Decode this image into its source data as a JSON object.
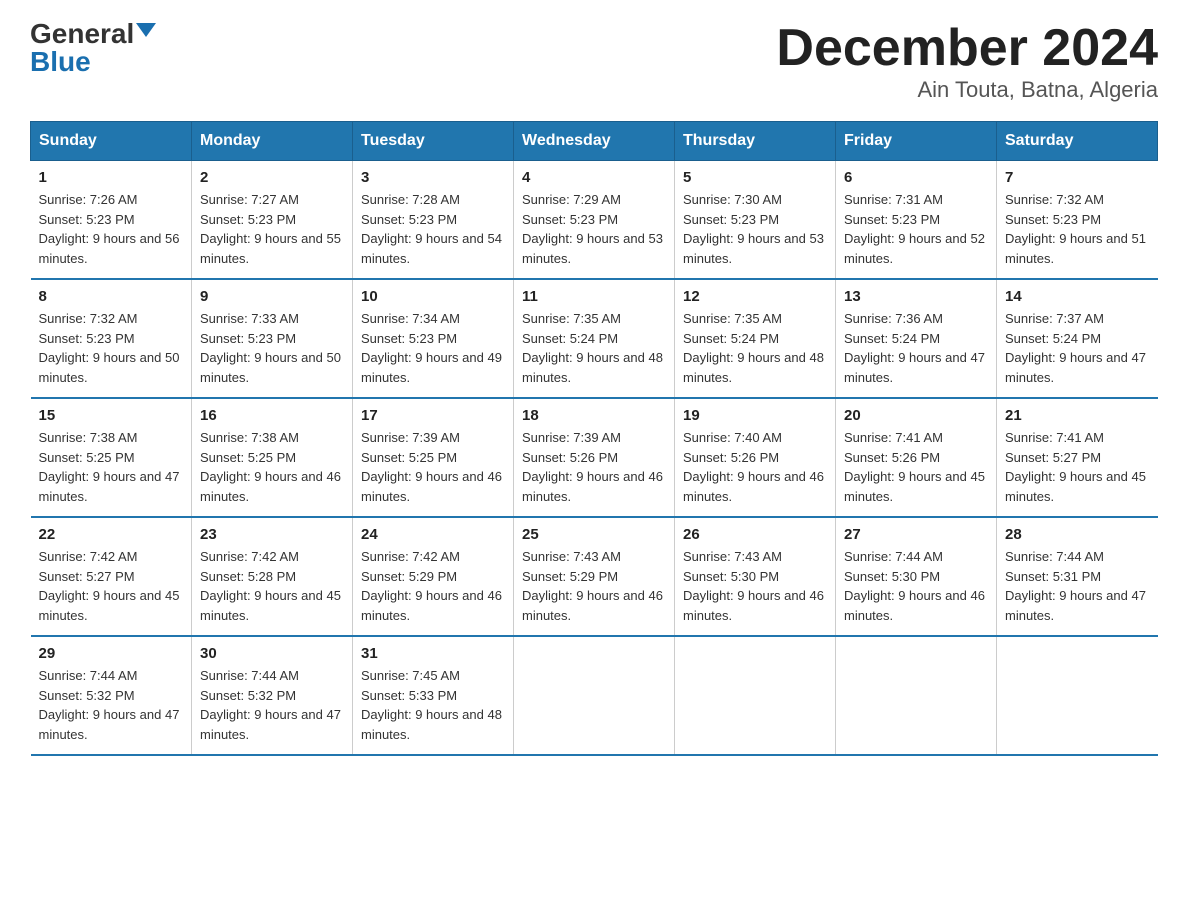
{
  "logo": {
    "general": "General",
    "blue": "Blue"
  },
  "header": {
    "month": "December 2024",
    "location": "Ain Touta, Batna, Algeria"
  },
  "days_of_week": [
    "Sunday",
    "Monday",
    "Tuesday",
    "Wednesday",
    "Thursday",
    "Friday",
    "Saturday"
  ],
  "weeks": [
    [
      {
        "day": "1",
        "sunrise": "7:26 AM",
        "sunset": "5:23 PM",
        "daylight": "9 hours and 56 minutes."
      },
      {
        "day": "2",
        "sunrise": "7:27 AM",
        "sunset": "5:23 PM",
        "daylight": "9 hours and 55 minutes."
      },
      {
        "day": "3",
        "sunrise": "7:28 AM",
        "sunset": "5:23 PM",
        "daylight": "9 hours and 54 minutes."
      },
      {
        "day": "4",
        "sunrise": "7:29 AM",
        "sunset": "5:23 PM",
        "daylight": "9 hours and 53 minutes."
      },
      {
        "day": "5",
        "sunrise": "7:30 AM",
        "sunset": "5:23 PM",
        "daylight": "9 hours and 53 minutes."
      },
      {
        "day": "6",
        "sunrise": "7:31 AM",
        "sunset": "5:23 PM",
        "daylight": "9 hours and 52 minutes."
      },
      {
        "day": "7",
        "sunrise": "7:32 AM",
        "sunset": "5:23 PM",
        "daylight": "9 hours and 51 minutes."
      }
    ],
    [
      {
        "day": "8",
        "sunrise": "7:32 AM",
        "sunset": "5:23 PM",
        "daylight": "9 hours and 50 minutes."
      },
      {
        "day": "9",
        "sunrise": "7:33 AM",
        "sunset": "5:23 PM",
        "daylight": "9 hours and 50 minutes."
      },
      {
        "day": "10",
        "sunrise": "7:34 AM",
        "sunset": "5:23 PM",
        "daylight": "9 hours and 49 minutes."
      },
      {
        "day": "11",
        "sunrise": "7:35 AM",
        "sunset": "5:24 PM",
        "daylight": "9 hours and 48 minutes."
      },
      {
        "day": "12",
        "sunrise": "7:35 AM",
        "sunset": "5:24 PM",
        "daylight": "9 hours and 48 minutes."
      },
      {
        "day": "13",
        "sunrise": "7:36 AM",
        "sunset": "5:24 PM",
        "daylight": "9 hours and 47 minutes."
      },
      {
        "day": "14",
        "sunrise": "7:37 AM",
        "sunset": "5:24 PM",
        "daylight": "9 hours and 47 minutes."
      }
    ],
    [
      {
        "day": "15",
        "sunrise": "7:38 AM",
        "sunset": "5:25 PM",
        "daylight": "9 hours and 47 minutes."
      },
      {
        "day": "16",
        "sunrise": "7:38 AM",
        "sunset": "5:25 PM",
        "daylight": "9 hours and 46 minutes."
      },
      {
        "day": "17",
        "sunrise": "7:39 AM",
        "sunset": "5:25 PM",
        "daylight": "9 hours and 46 minutes."
      },
      {
        "day": "18",
        "sunrise": "7:39 AM",
        "sunset": "5:26 PM",
        "daylight": "9 hours and 46 minutes."
      },
      {
        "day": "19",
        "sunrise": "7:40 AM",
        "sunset": "5:26 PM",
        "daylight": "9 hours and 46 minutes."
      },
      {
        "day": "20",
        "sunrise": "7:41 AM",
        "sunset": "5:26 PM",
        "daylight": "9 hours and 45 minutes."
      },
      {
        "day": "21",
        "sunrise": "7:41 AM",
        "sunset": "5:27 PM",
        "daylight": "9 hours and 45 minutes."
      }
    ],
    [
      {
        "day": "22",
        "sunrise": "7:42 AM",
        "sunset": "5:27 PM",
        "daylight": "9 hours and 45 minutes."
      },
      {
        "day": "23",
        "sunrise": "7:42 AM",
        "sunset": "5:28 PM",
        "daylight": "9 hours and 45 minutes."
      },
      {
        "day": "24",
        "sunrise": "7:42 AM",
        "sunset": "5:29 PM",
        "daylight": "9 hours and 46 minutes."
      },
      {
        "day": "25",
        "sunrise": "7:43 AM",
        "sunset": "5:29 PM",
        "daylight": "9 hours and 46 minutes."
      },
      {
        "day": "26",
        "sunrise": "7:43 AM",
        "sunset": "5:30 PM",
        "daylight": "9 hours and 46 minutes."
      },
      {
        "day": "27",
        "sunrise": "7:44 AM",
        "sunset": "5:30 PM",
        "daylight": "9 hours and 46 minutes."
      },
      {
        "day": "28",
        "sunrise": "7:44 AM",
        "sunset": "5:31 PM",
        "daylight": "9 hours and 47 minutes."
      }
    ],
    [
      {
        "day": "29",
        "sunrise": "7:44 AM",
        "sunset": "5:32 PM",
        "daylight": "9 hours and 47 minutes."
      },
      {
        "day": "30",
        "sunrise": "7:44 AM",
        "sunset": "5:32 PM",
        "daylight": "9 hours and 47 minutes."
      },
      {
        "day": "31",
        "sunrise": "7:45 AM",
        "sunset": "5:33 PM",
        "daylight": "9 hours and 48 minutes."
      },
      null,
      null,
      null,
      null
    ]
  ]
}
